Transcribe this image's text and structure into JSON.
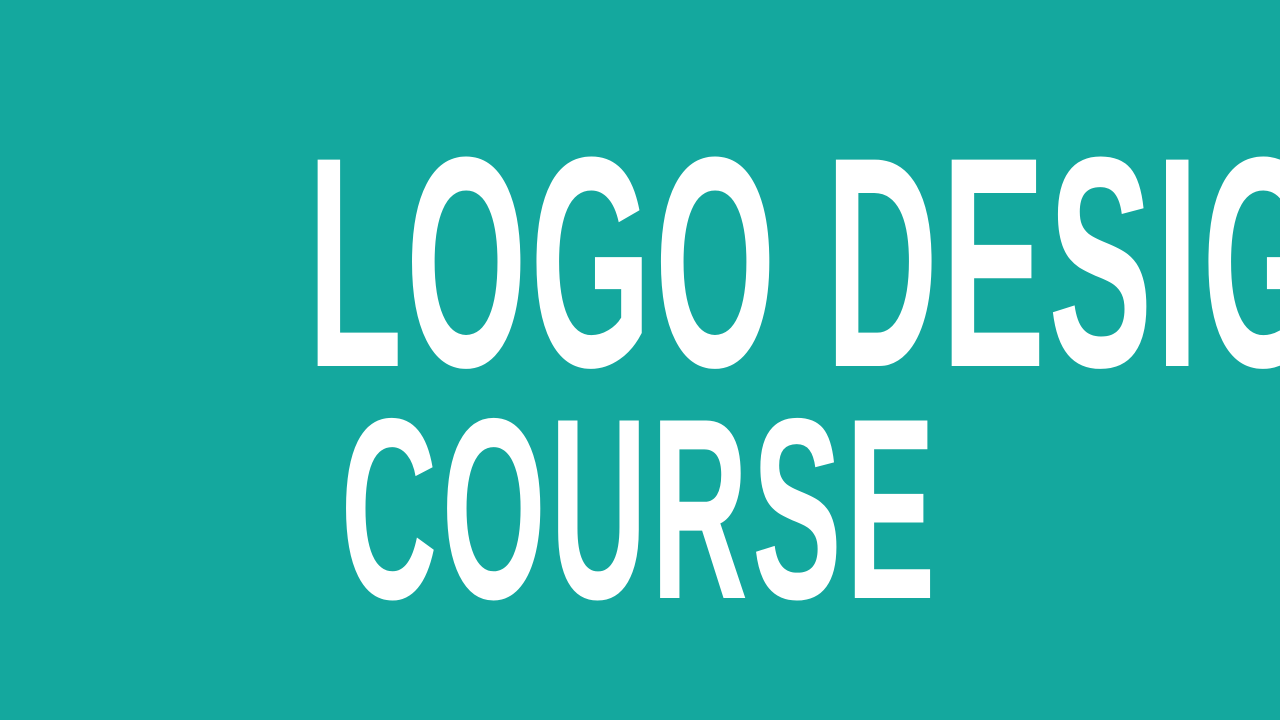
{
  "background": {
    "color": "#14a89e"
  },
  "title": {
    "line1": "LOGO DESIGN",
    "line2": "COURSE",
    "color": "#ffffff"
  }
}
